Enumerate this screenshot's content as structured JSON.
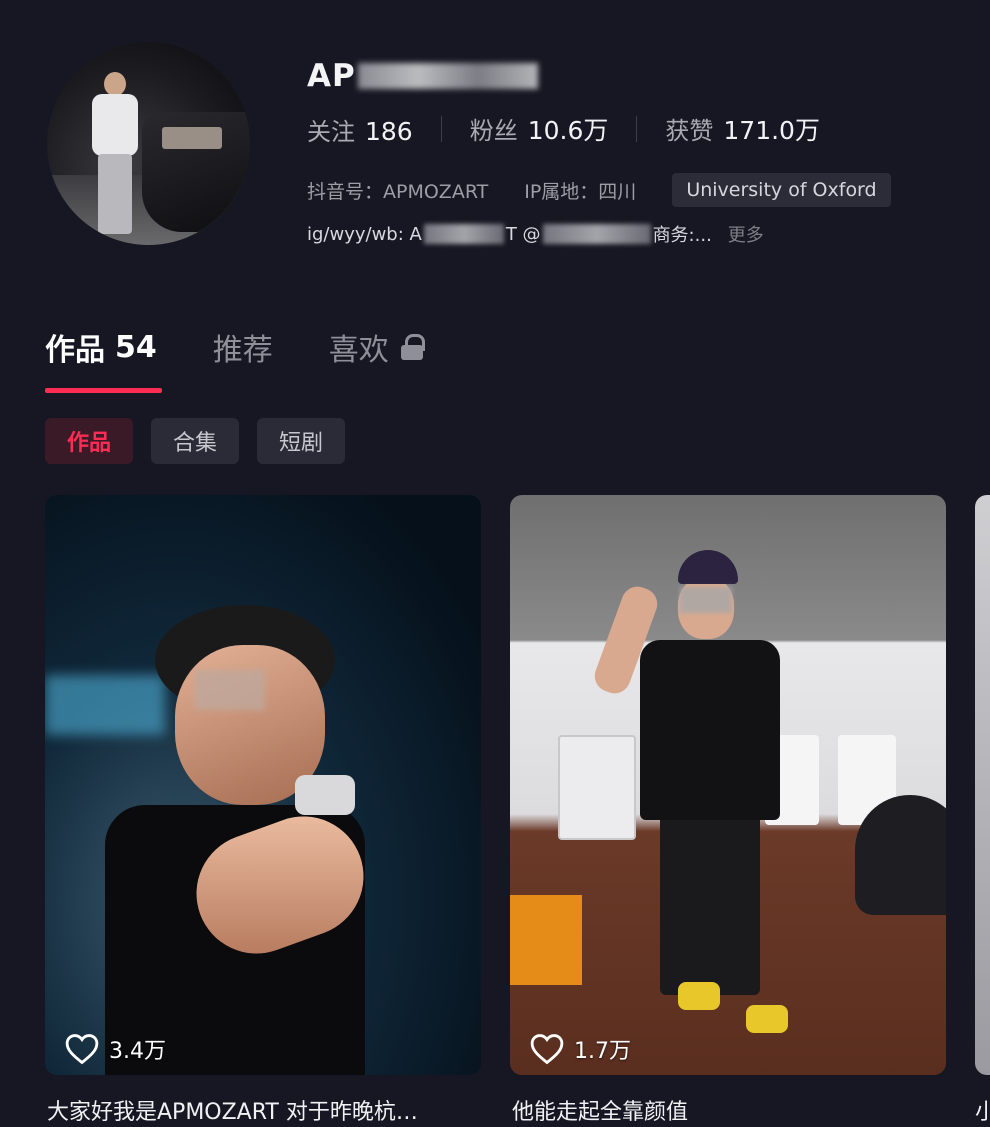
{
  "profile": {
    "username": "AP",
    "stats": [
      {
        "label": "关注",
        "value": "186"
      },
      {
        "label": "粉丝",
        "value": "10.6万"
      },
      {
        "label": "获赞",
        "value": "171.0万"
      }
    ],
    "douyin_id": "抖音号：APMOZART",
    "ip_location": "IP属地：四川",
    "school": "University of Oxford",
    "bio_prefix": "ig/wyy/wb: A",
    "bio_mid": "T @",
    "bio_suffix": " 商务:...",
    "bio_more": "更多"
  },
  "tabs": [
    {
      "label": "作品",
      "count": "54"
    },
    {
      "label": "推荐"
    },
    {
      "label": "喜欢"
    }
  ],
  "chips": [
    "作品",
    "合集",
    "短剧"
  ],
  "videos": [
    {
      "likes": "3.4万",
      "title": "大家好我是APMOZART 对于昨晚杭…"
    },
    {
      "likes": "1.7万",
      "title": "他能走起全靠颜值"
    },
    {
      "title": "小"
    }
  ],
  "colors": {
    "accent": "#fe2c55",
    "background": "#161722"
  },
  "icons": {
    "lock": "lock-icon",
    "heart": "heart-icon"
  }
}
